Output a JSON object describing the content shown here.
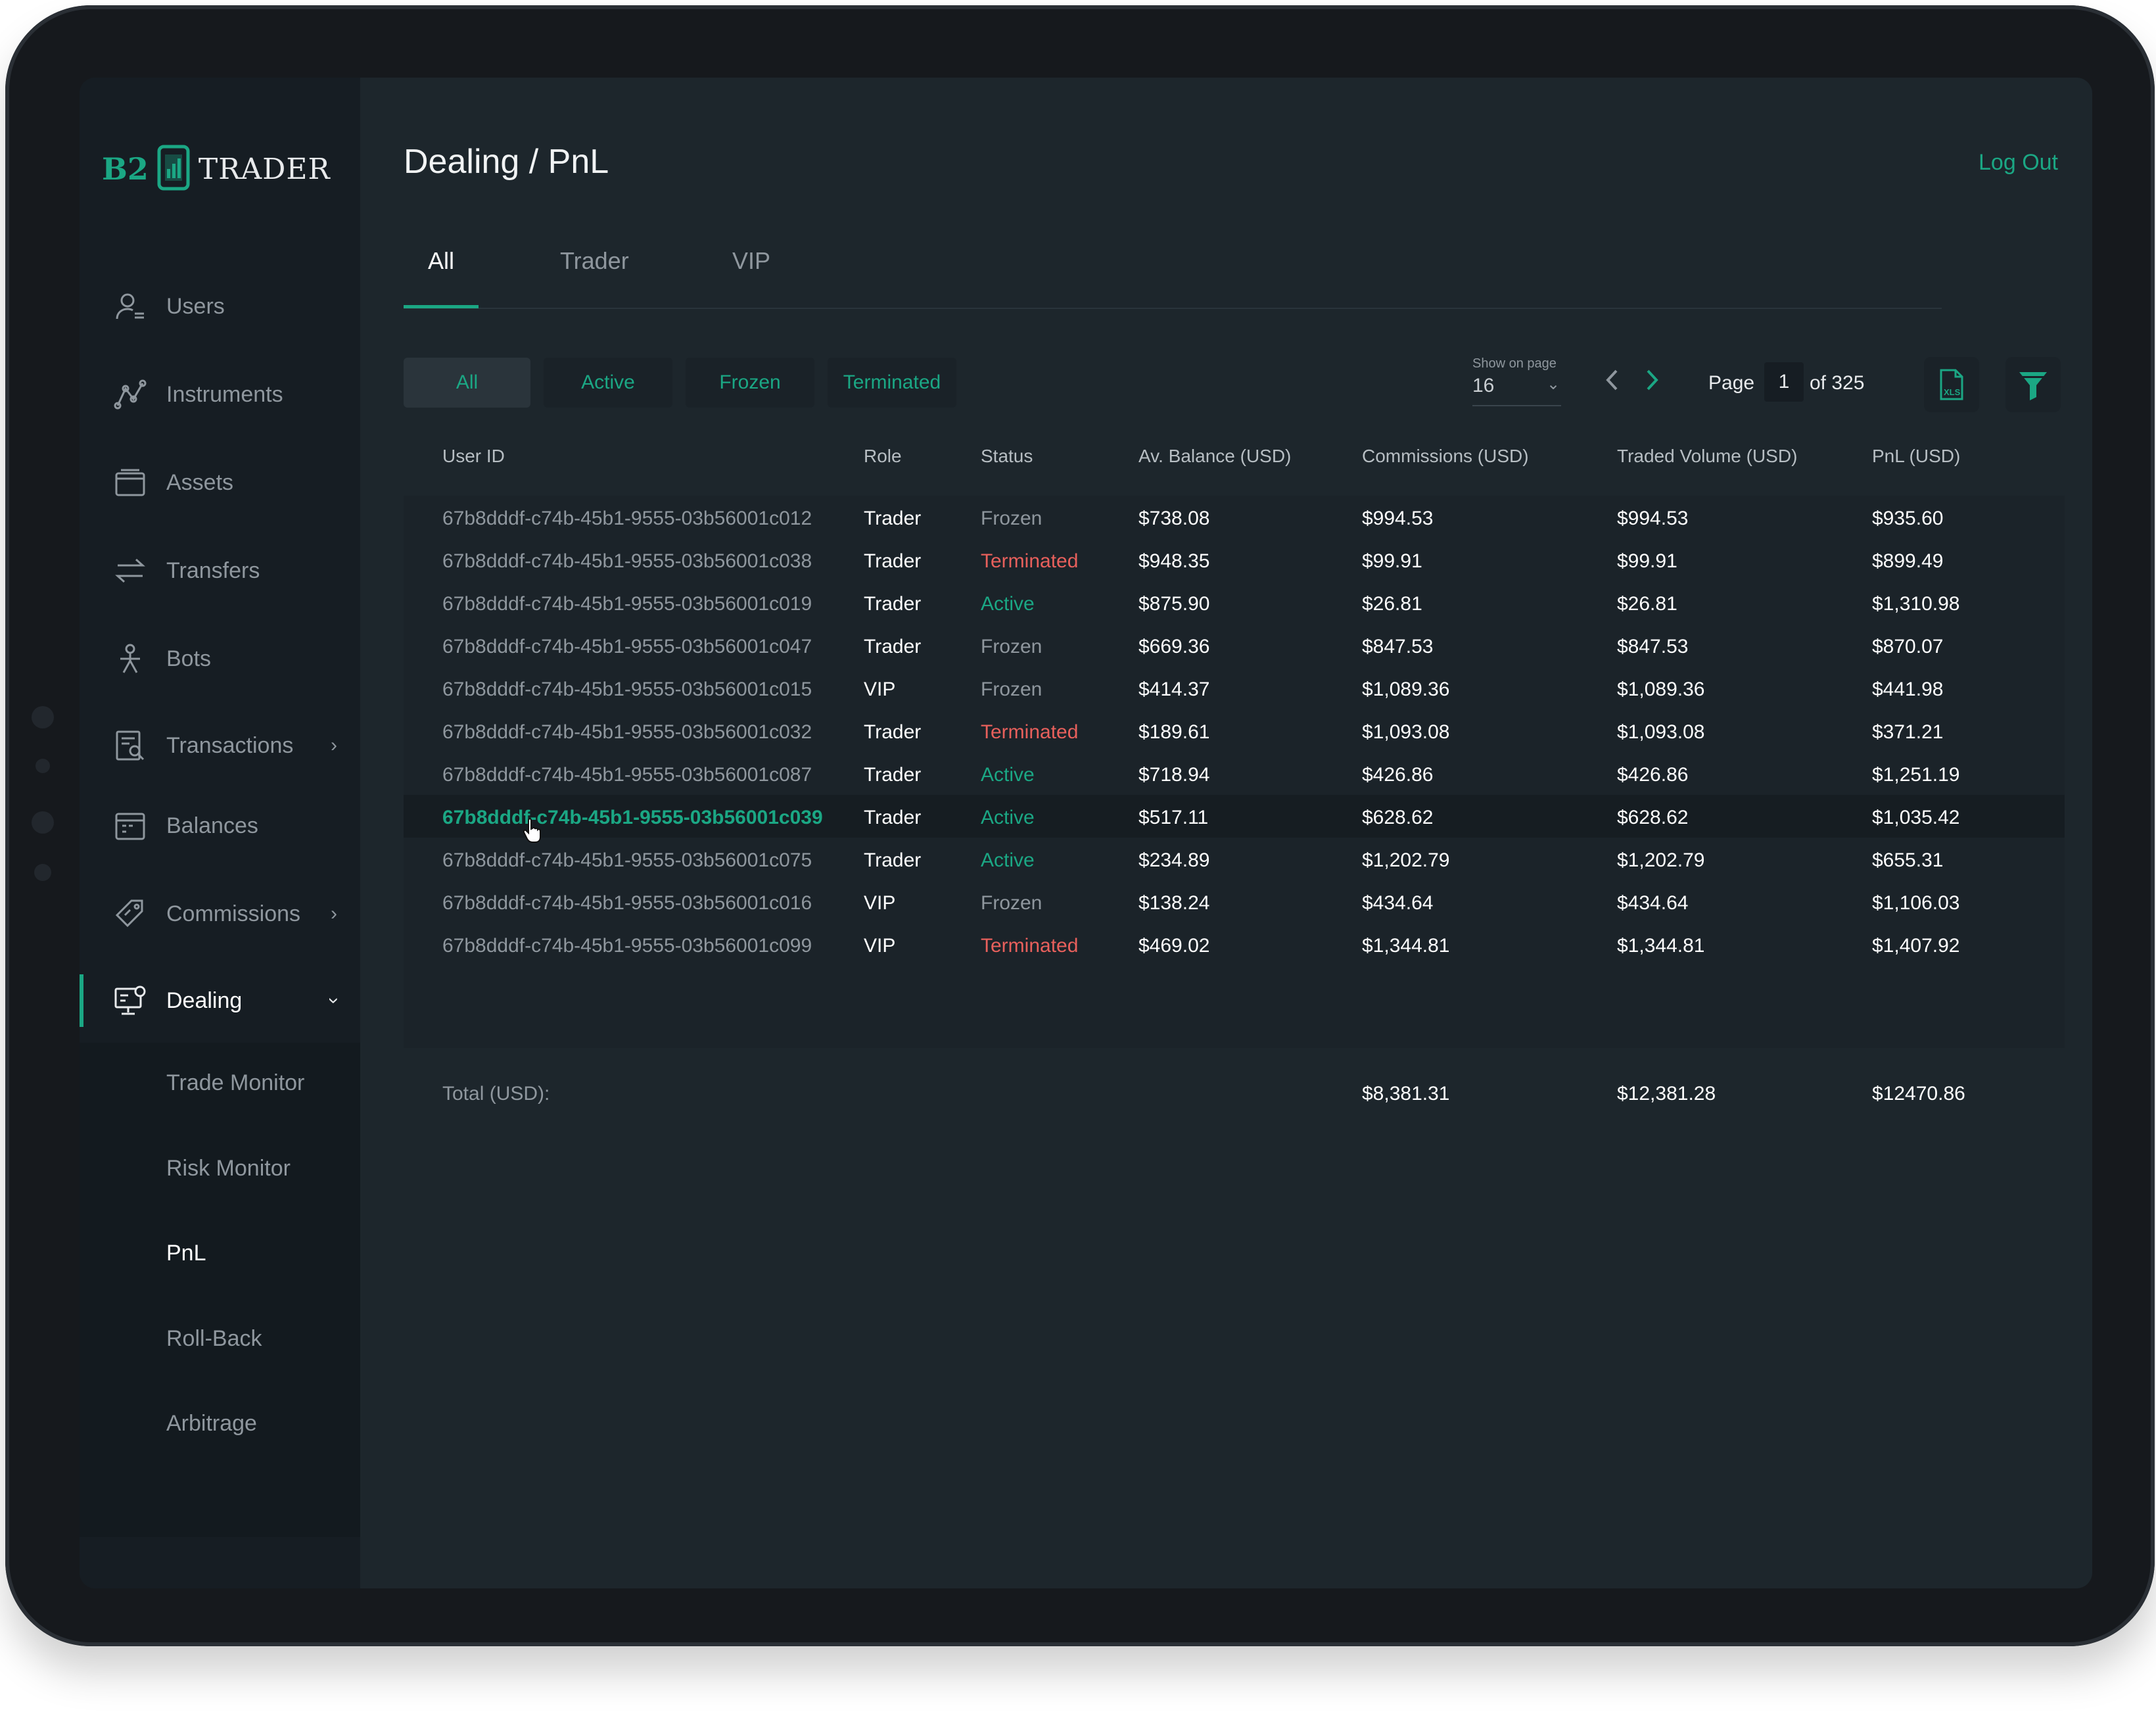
{
  "brand": {
    "prefix": "B2",
    "name": "TRADER"
  },
  "page_title": "Dealing / PnL",
  "logout_label": "Log Out",
  "sidebar": {
    "items": [
      {
        "label": "Users",
        "icon": "user-list-icon"
      },
      {
        "label": "Instruments",
        "icon": "chart-line-icon"
      },
      {
        "label": "Assets",
        "icon": "wallet-icon"
      },
      {
        "label": "Transfers",
        "icon": "transfer-arrows-icon"
      },
      {
        "label": "Bots",
        "icon": "bot-icon"
      },
      {
        "label": "Transactions",
        "icon": "receipt-search-icon",
        "expandable": true
      },
      {
        "label": "Balances",
        "icon": "calendar-icon"
      },
      {
        "label": "Commissions",
        "icon": "tag-icon",
        "expandable": true
      },
      {
        "label": "Dealing",
        "icon": "monitor-icon",
        "expanded": true,
        "active": true
      }
    ],
    "dealing_sub_items": [
      "Trade Monitor",
      "Risk Monitor",
      "PnL",
      "Roll-Back",
      "Arbitrage"
    ],
    "current_sub_item": "PnL"
  },
  "tabs": [
    "All",
    "Trader",
    "VIP"
  ],
  "active_tab": "All",
  "status_filters": [
    "All",
    "Active",
    "Frozen",
    "Terminated"
  ],
  "active_status_filter": "All",
  "pagination": {
    "show_on_page_label": "Show on page",
    "show_on_page_value": "16",
    "page_label": "Page",
    "current_page": "1",
    "of_label": "of 325"
  },
  "table": {
    "columns": [
      "User ID",
      "Role",
      "Status",
      "Av. Balance (USD)",
      "Commissions (USD)",
      "Traded Volume (USD)",
      "PnL (USD)"
    ],
    "rows": [
      [
        "67b8dddf-c74b-45b1-9555-03b56001c012",
        "Trader",
        "Frozen",
        "$738.08",
        "$994.53",
        "$994.53",
        "$935.60"
      ],
      [
        "67b8dddf-c74b-45b1-9555-03b56001c038",
        "Trader",
        "Terminated",
        "$948.35",
        "$99.91",
        "$99.91",
        "$899.49"
      ],
      [
        "67b8dddf-c74b-45b1-9555-03b56001c019",
        "Trader",
        "Active",
        "$875.90",
        "$26.81",
        "$26.81",
        "$1,310.98"
      ],
      [
        "67b8dddf-c74b-45b1-9555-03b56001c047",
        "Trader",
        "Frozen",
        "$669.36",
        "$847.53",
        "$847.53",
        "$870.07"
      ],
      [
        "67b8dddf-c74b-45b1-9555-03b56001c015",
        "VIP",
        "Frozen",
        "$414.37",
        "$1,089.36",
        "$1,089.36",
        "$441.98"
      ],
      [
        "67b8dddf-c74b-45b1-9555-03b56001c032",
        "Trader",
        "Terminated",
        "$189.61",
        "$1,093.08",
        "$1,093.08",
        "$371.21"
      ],
      [
        "67b8dddf-c74b-45b1-9555-03b56001c087",
        "Trader",
        "Active",
        "$718.94",
        "$426.86",
        "$426.86",
        "$1,251.19"
      ],
      [
        "67b8dddf-c74b-45b1-9555-03b56001c039",
        "Trader",
        "Active",
        "$517.11",
        "$628.62",
        "$628.62",
        "$1,035.42"
      ],
      [
        "67b8dddf-c74b-45b1-9555-03b56001c075",
        "Trader",
        "Active",
        "$234.89",
        "$1,202.79",
        "$1,202.79",
        "$655.31"
      ],
      [
        "67b8dddf-c74b-45b1-9555-03b56001c016",
        "VIP",
        "Frozen",
        "$138.24",
        "$434.64",
        "$434.64",
        "$1,106.03"
      ],
      [
        "67b8dddf-c74b-45b1-9555-03b56001c099",
        "VIP",
        "Terminated",
        "$469.02",
        "$1,344.81",
        "$1,344.81",
        "$1,407.92"
      ]
    ],
    "hovered_row": 7,
    "total_label": "Total (USD):",
    "totals": {
      "commissions": "$8,381.31",
      "traded_volume": "$12,381.28",
      "pnl": "$12470.86"
    }
  },
  "colors": {
    "accent": "#1ba784",
    "terminated": "#e8605c",
    "frozen": "#8f979e",
    "background": "#1d262c",
    "sidebar": "#161d23"
  }
}
